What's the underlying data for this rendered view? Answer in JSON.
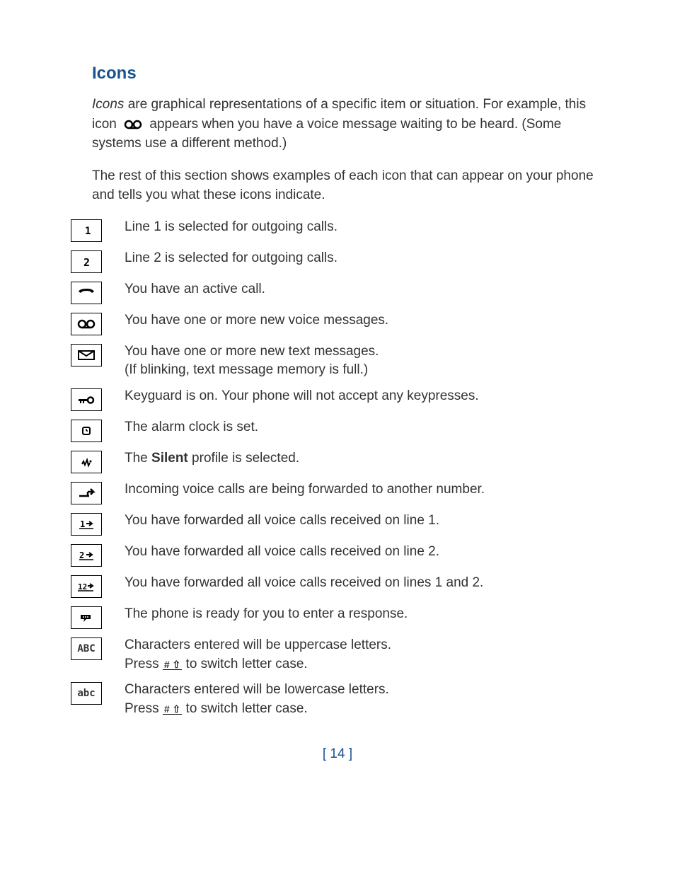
{
  "heading": "Icons",
  "intro1_a": "Icons",
  "intro1_b": " are graphical representations of a specific item or situation. For example, this icon ",
  "intro1_c": " appears when you have a voice message waiting to be heard. (Some systems use a different method.)",
  "intro2": "The rest of this section shows examples of each icon that can appear on your phone and tells you what these icons indicate.",
  "rows": [
    {
      "icon": "line1",
      "desc": "Line 1 is selected for outgoing calls."
    },
    {
      "icon": "line2",
      "desc": "Line 2 is selected for outgoing calls."
    },
    {
      "icon": "handset",
      "desc": "You have an active call."
    },
    {
      "icon": "voicemail",
      "desc": "You have one or more new voice messages."
    },
    {
      "icon": "envelope",
      "desc": "You have one or more new text messages.\n(If blinking, text message memory is full.)"
    },
    {
      "icon": "key",
      "desc": "Keyguard is on. Your phone will not accept any keypresses."
    },
    {
      "icon": "clock",
      "desc": "The alarm clock is set."
    },
    {
      "icon": "silent",
      "desc_html": "The <b>Silent</b> profile is selected."
    },
    {
      "icon": "fwd",
      "desc": "Incoming voice calls are being forwarded to another number."
    },
    {
      "icon": "fwd1",
      "desc": "You have forwarded all voice calls received on line 1."
    },
    {
      "icon": "fwd2",
      "desc": "You have forwarded all voice calls received on line 2."
    },
    {
      "icon": "fwd12",
      "desc": "You have forwarded all voice calls received on lines 1 and 2."
    },
    {
      "icon": "response",
      "desc": "The phone is ready for you to enter a response."
    },
    {
      "icon": "ABC",
      "desc_html": "Characters entered will be uppercase letters.\nPress <span class=\"key\">#&nbsp;⇧</span> to switch letter case."
    },
    {
      "icon": "abc",
      "desc_html": "Characters entered will be lowercase letters.\nPress <span class=\"key\">#&nbsp;⇧</span> to switch letter case."
    }
  ],
  "page_number": "[ 14 ]"
}
